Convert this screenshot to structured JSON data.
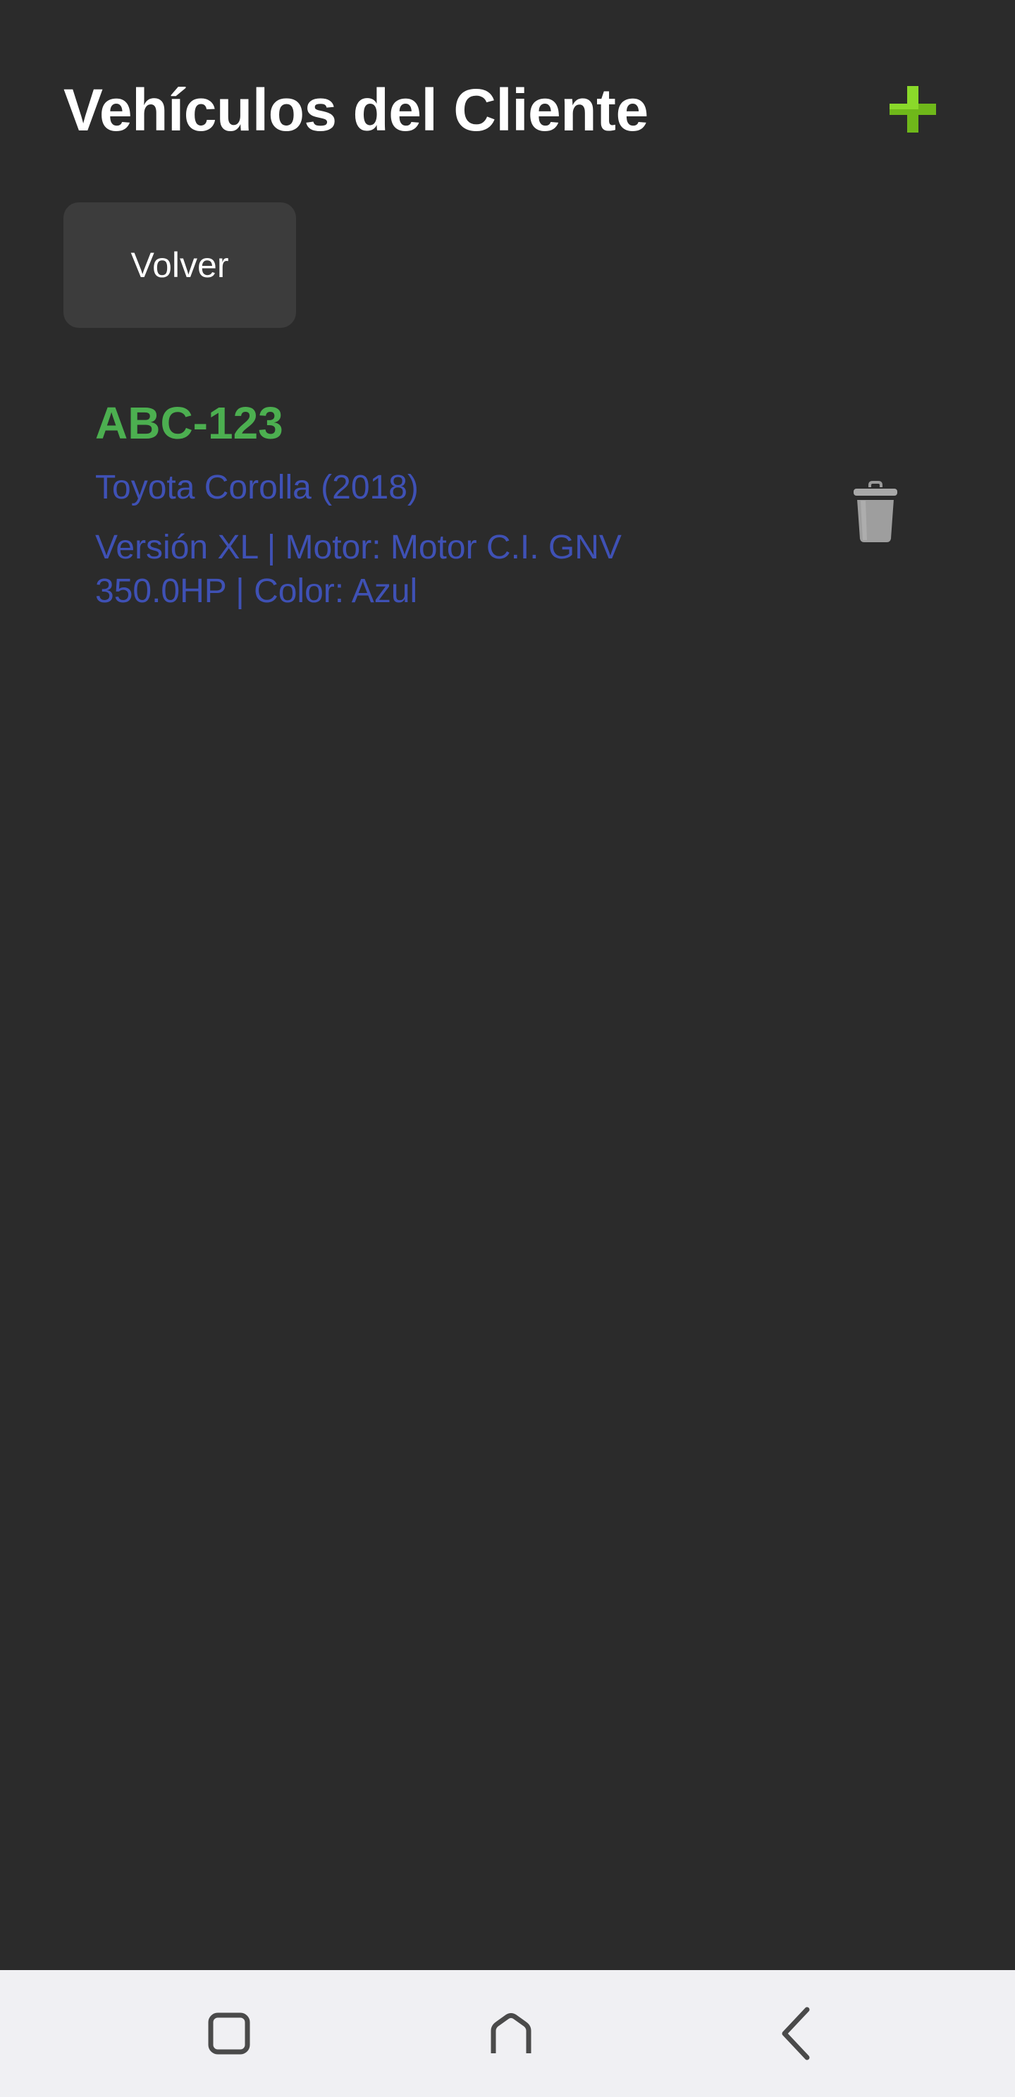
{
  "header": {
    "title": "Vehículos del Cliente",
    "add_icon": "plus-icon",
    "accent_color": "#7cc91f"
  },
  "actions": {
    "back_label": "Volver"
  },
  "vehicles": [
    {
      "plate": "ABC-123",
      "model": "Toyota Corolla (2018)",
      "details": "Versión XL | Motor: Motor C.I. GNV 350.0HP | Color: Azul",
      "delete_icon": "trash-icon"
    }
  ],
  "colors": {
    "background": "#2b2b2b",
    "plate": "#4caf50",
    "info": "#3f51b5",
    "button": "#3c3c3c",
    "navbar": "#f0f0f3"
  },
  "navbar": {
    "icons": [
      "recents-icon",
      "home-icon",
      "back-icon"
    ]
  }
}
